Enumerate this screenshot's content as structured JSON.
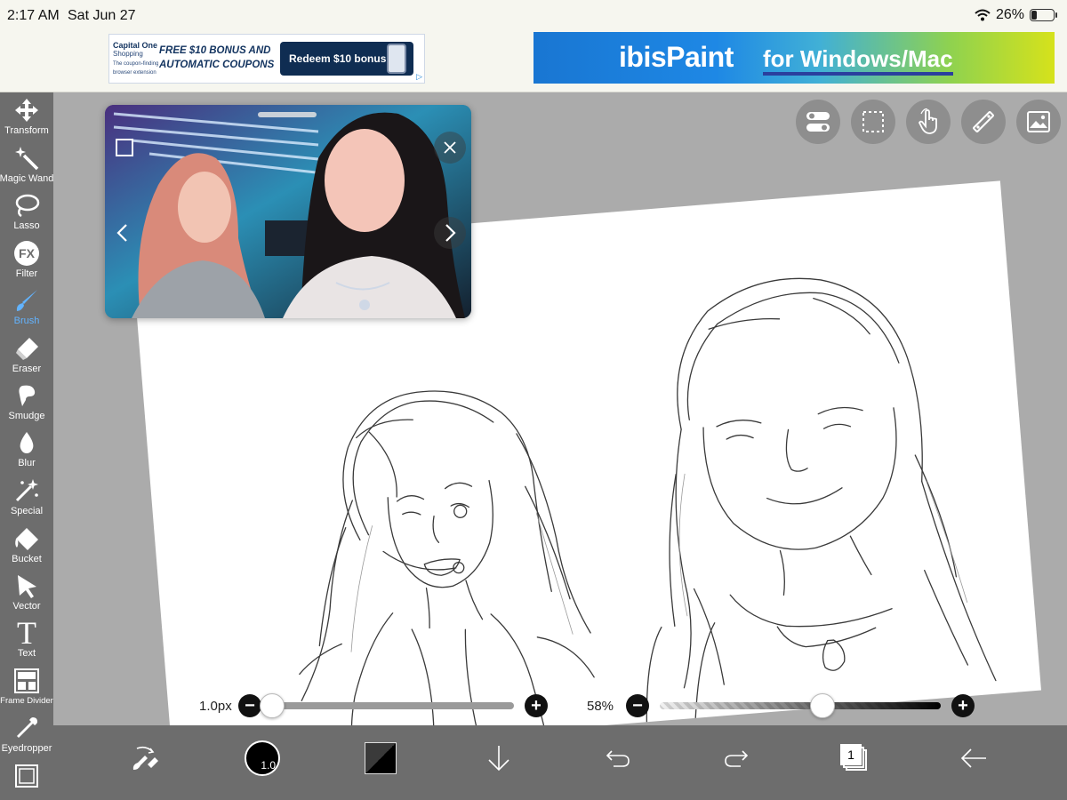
{
  "status_bar": {
    "time": "2:17 AM",
    "date": "Sat Jun 27",
    "battery_percent": "26%",
    "battery_level": 0.26
  },
  "ads": {
    "left": {
      "brand": "Capital One",
      "brand_sub": "Shopping",
      "brand_tagline": "The coupon-finding browser extension",
      "headline": "FREE $10 BONUS AND AUTOMATIC COUPONS",
      "cta": "Redeem $10 bonus"
    },
    "right": {
      "logo": "ibisPaint",
      "slogan": "for Windows/Mac"
    }
  },
  "tools": [
    {
      "label": "Transform",
      "icon": "move-arrows-icon"
    },
    {
      "label": "Magic Wand",
      "icon": "magic-wand-icon"
    },
    {
      "label": "Lasso",
      "icon": "lasso-icon"
    },
    {
      "label": "Filter",
      "icon": "fx-icon",
      "glyph": "FX"
    },
    {
      "label": "Brush",
      "icon": "brush-icon",
      "active": true
    },
    {
      "label": "Eraser",
      "icon": "eraser-icon"
    },
    {
      "label": "Smudge",
      "icon": "smudge-icon"
    },
    {
      "label": "Blur",
      "icon": "drop-icon"
    },
    {
      "label": "Special",
      "icon": "sparkle-icon"
    },
    {
      "label": "Bucket",
      "icon": "bucket-icon"
    },
    {
      "label": "Vector",
      "icon": "cursor-arrow-icon"
    },
    {
      "label": "Text",
      "icon": "text-icon",
      "glyph": "T"
    },
    {
      "label": "Frame Divider",
      "icon": "frame-divider-icon"
    },
    {
      "label": "Eyedropper",
      "icon": "eyedropper-icon"
    },
    {
      "label": "",
      "icon": "canvas-icon"
    }
  ],
  "top_buttons": [
    "toggle-icon",
    "selection-icon",
    "touch-hand-icon",
    "ruler-icon",
    "image-icon"
  ],
  "sliders": {
    "size": {
      "label": "1.0px",
      "value": 1.0,
      "fraction": 0.0
    },
    "opacity": {
      "label": "58%",
      "value": 58,
      "fraction": 0.58
    }
  },
  "bottom_bar": {
    "brush_size_label": "1.0",
    "layer_count": "1"
  },
  "colors": {
    "toolbar_bg": "#6d6d6d",
    "workspace_bg": "#ababab",
    "accent": "#62b3ff"
  }
}
